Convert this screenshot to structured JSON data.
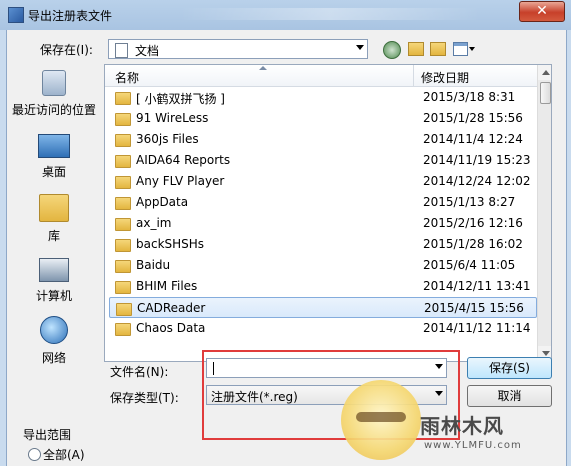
{
  "window": {
    "title": "导出注册表文件",
    "close_symbol": "✕"
  },
  "save_in": {
    "label": "保存在(I):",
    "value": "文档"
  },
  "places": [
    {
      "label": "最近访问的位置",
      "icon": "recent-places-icon"
    },
    {
      "label": "桌面",
      "icon": "desktop-icon"
    },
    {
      "label": "库",
      "icon": "libraries-icon"
    },
    {
      "label": "计算机",
      "icon": "computer-icon"
    },
    {
      "label": "网络",
      "icon": "network-icon"
    }
  ],
  "filelist": {
    "columns": {
      "name": "名称",
      "date": "修改日期"
    },
    "rows": [
      {
        "name": "[ 小鹤双拼飞扬 ]",
        "date": "2015/3/18 8:31"
      },
      {
        "name": "91 WireLess",
        "date": "2015/1/28 15:56"
      },
      {
        "name": "360js Files",
        "date": "2014/11/4 12:24"
      },
      {
        "name": "AIDA64 Reports",
        "date": "2014/11/19 15:23"
      },
      {
        "name": "Any FLV Player",
        "date": "2014/12/24 12:02"
      },
      {
        "name": "AppData",
        "date": "2015/1/13 8:27"
      },
      {
        "name": "ax_im",
        "date": "2015/2/16 12:16"
      },
      {
        "name": "backSHSHs",
        "date": "2015/1/28 16:02"
      },
      {
        "name": "Baidu",
        "date": "2015/6/4 11:05"
      },
      {
        "name": "BHIM Files",
        "date": "2014/12/11 13:41"
      },
      {
        "name": "CADReader",
        "date": "2015/4/15 15:56"
      },
      {
        "name": "Chaos Data",
        "date": "2014/11/12 11:14"
      }
    ]
  },
  "filename": {
    "label": "文件名(N):",
    "value": ""
  },
  "filetype": {
    "label": "保存类型(T):",
    "value": "注册文件(*.reg)"
  },
  "buttons": {
    "save": "保存(S)",
    "cancel": "取消"
  },
  "export_range": {
    "label": "导出范围",
    "option_all": "全部(A)"
  },
  "watermark": {
    "text": "雨林木风",
    "url": "www.YLMFU.com"
  }
}
